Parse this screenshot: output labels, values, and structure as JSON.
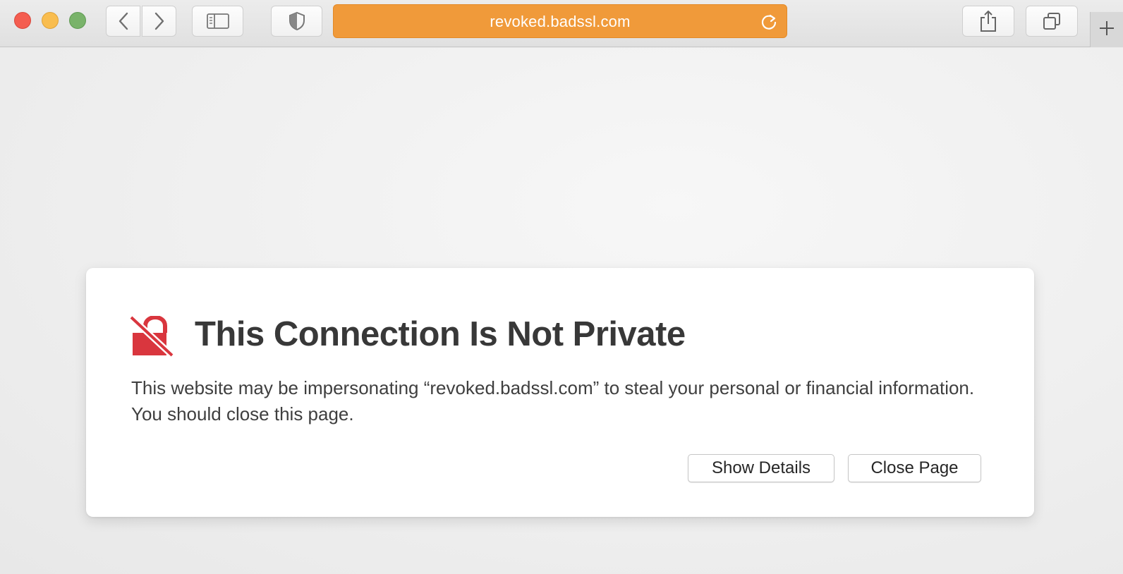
{
  "browser": {
    "url": "revoked.badssl.com",
    "url_bar_color": "#f09a3a",
    "icons": {
      "back": "chevron-left-icon",
      "forward": "chevron-right-icon",
      "sidebar": "sidebar-icon",
      "privacy": "shield-icon",
      "reload": "reload-icon",
      "share": "share-icon",
      "tabs": "tab-overview-icon",
      "new_tab": "plus-icon"
    }
  },
  "warning": {
    "icon": "broken-lock-icon",
    "icon_color": "#d9363e",
    "title": "This Connection Is Not Private",
    "message": "This website may be impersonating “revoked.badssl.com” to steal your personal or financial information. You should close this page.",
    "show_details_label": "Show Details",
    "close_page_label": "Close Page"
  }
}
